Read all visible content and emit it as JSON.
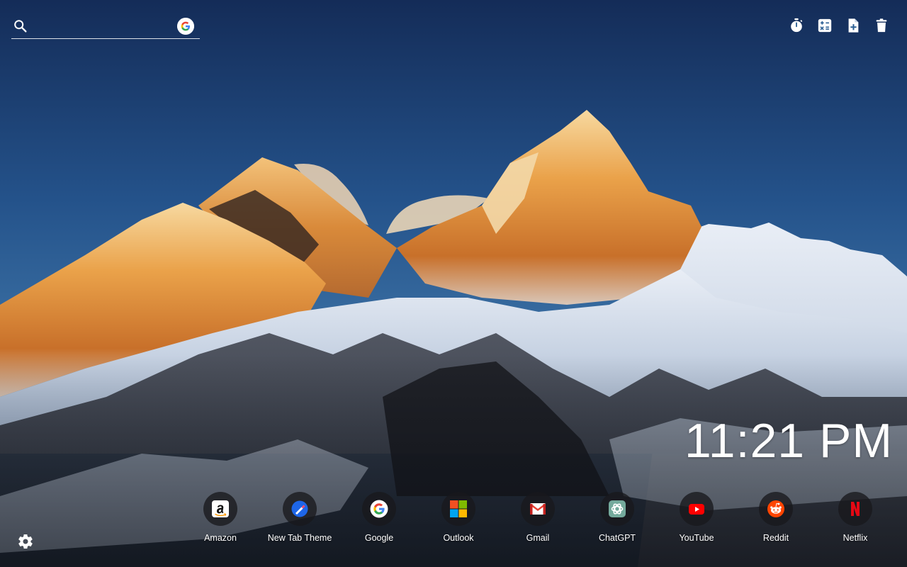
{
  "search": {
    "value": "",
    "placeholder": ""
  },
  "toolbar": {
    "icons": [
      "timer-icon",
      "calculator-icon",
      "add-note-icon",
      "delete-icon"
    ]
  },
  "clock": {
    "time": "11:21 PM"
  },
  "shortcuts": [
    {
      "label": "Amazon",
      "icon": "amazon-icon"
    },
    {
      "label": "New Tab Theme",
      "icon": "new-tab-theme-icon"
    },
    {
      "label": "Google",
      "icon": "google-icon"
    },
    {
      "label": "Outlook",
      "icon": "outlook-icon"
    },
    {
      "label": "Gmail",
      "icon": "gmail-icon"
    },
    {
      "label": "ChatGPT",
      "icon": "chatgpt-icon"
    },
    {
      "label": "YouTube",
      "icon": "youtube-icon"
    },
    {
      "label": "Reddit",
      "icon": "reddit-icon"
    },
    {
      "label": "Netflix",
      "icon": "netflix-icon"
    }
  ],
  "colors": {
    "sky_top": "#16305e",
    "sky_bottom": "#3a6da0",
    "peak_glow": "#f0a040",
    "snow": "#dfe7f2",
    "rock": "#2d2f36"
  }
}
